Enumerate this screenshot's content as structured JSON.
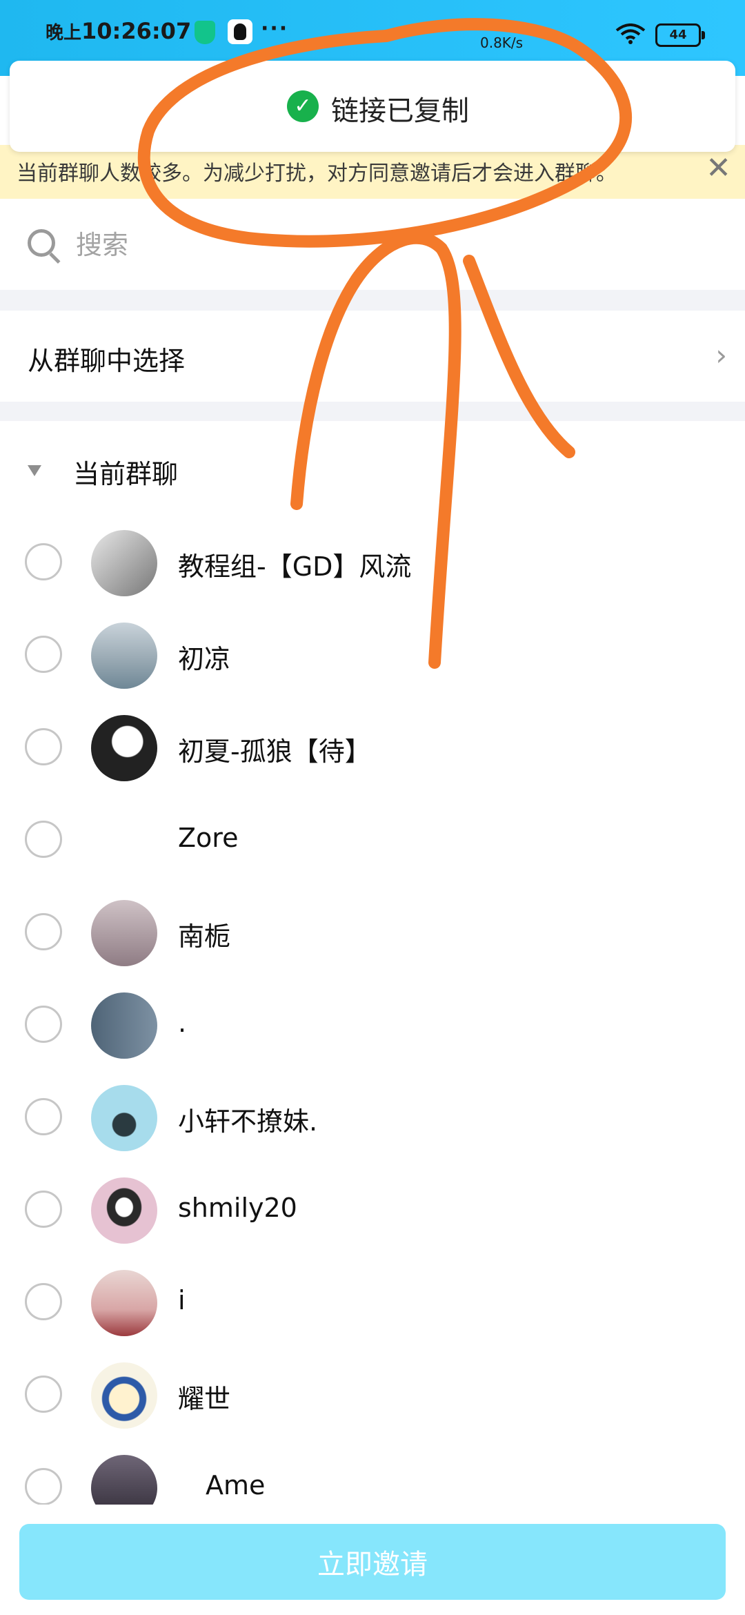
{
  "status_bar": {
    "time_prefix": "晚上",
    "time": "10:26:07",
    "network_speed": "0.8K/s",
    "battery": "44"
  },
  "toast": {
    "text": "链接已复制"
  },
  "notice": {
    "text": "当前群聊人数较多。为减少打扰，对方同意邀请后才会进入群聊。"
  },
  "search": {
    "placeholder": "搜索"
  },
  "select_from_group": {
    "label": "从群聊中选择"
  },
  "section": {
    "title": "当前群聊"
  },
  "members": [
    {
      "name": "教程组-【GD】风流",
      "avatar_color": "#9a9a9a"
    },
    {
      "name": "初凉",
      "avatar_color": "#8aa0ae"
    },
    {
      "name": "初夏-孤狼【待】",
      "avatar_color": "#2a2a2a"
    },
    {
      "name": "Zore",
      "avatar_color": "#ffffff"
    },
    {
      "name": "南栀",
      "avatar_color": "#b79aa2"
    },
    {
      "name": ".",
      "avatar_color": "#5f7487"
    },
    {
      "name": "小轩不撩妹.",
      "avatar_color": "#9fd6e8"
    },
    {
      "name": "shmily20",
      "avatar_color": "#e6c2d2"
    },
    {
      "name": "i",
      "avatar_color": "#d9a0a2"
    },
    {
      "name": "耀世",
      "avatar_color": "#f3e9c0"
    },
    {
      "name": "Ame",
      "avatar_color": "#4a4250"
    }
  ],
  "invite_button": {
    "label": "立即邀请"
  },
  "colors": {
    "status_bar": "#2ec6ff",
    "notice_bg": "#fff4c4",
    "button_bg": "#86e6fc",
    "toast_check": "#18b14c",
    "annotation": "#f47a2a"
  }
}
